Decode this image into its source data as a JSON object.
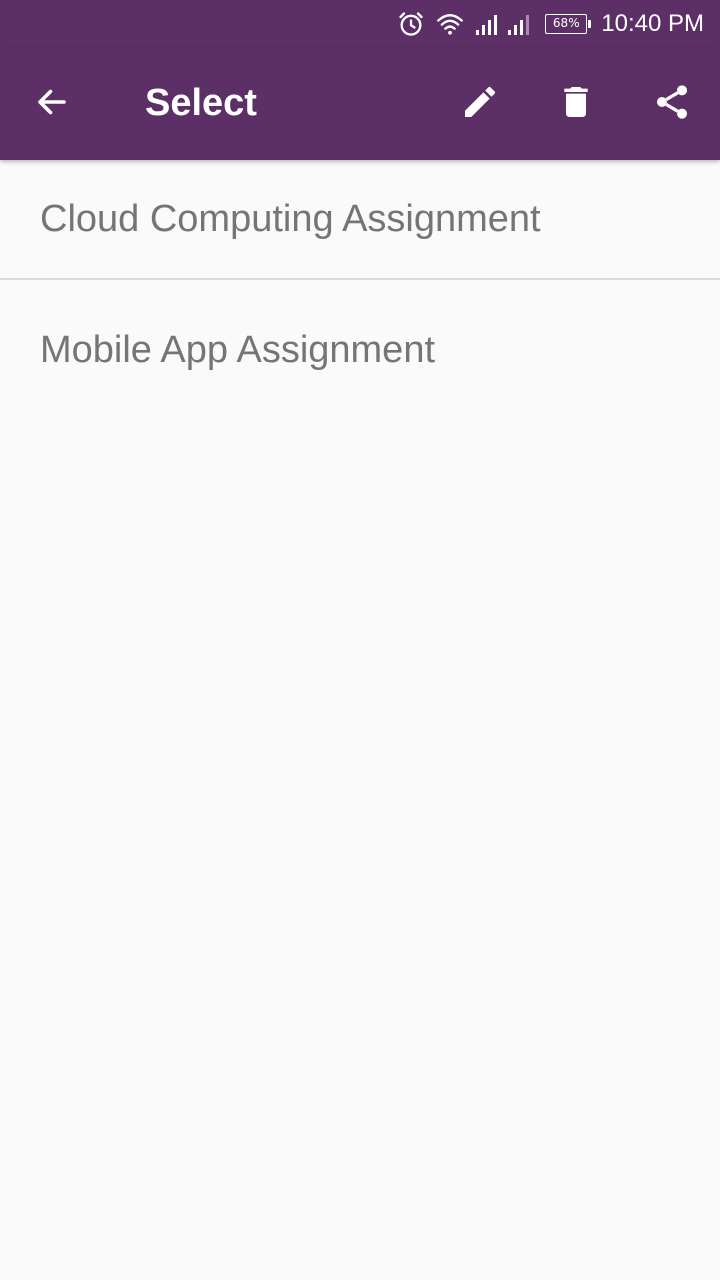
{
  "status_bar": {
    "icons": [
      "alarm-icon",
      "wifi-icon",
      "signal-icon",
      "signal-icon-2"
    ],
    "battery_percent": "68%",
    "time": "10:40 PM"
  },
  "app_bar": {
    "title": "Select",
    "back_icon": "arrow-left-icon",
    "actions": [
      "pencil-icon",
      "trash-icon",
      "share-icon"
    ],
    "color": "#5c3066"
  },
  "list": {
    "items": [
      {
        "label": "Cloud Computing Assignment"
      },
      {
        "label": "Mobile App Assignment"
      }
    ]
  },
  "colors": {
    "primary": "#5c3066",
    "background": "#fafafa",
    "item_text": "#757575",
    "divider": "#dcdcdc"
  }
}
